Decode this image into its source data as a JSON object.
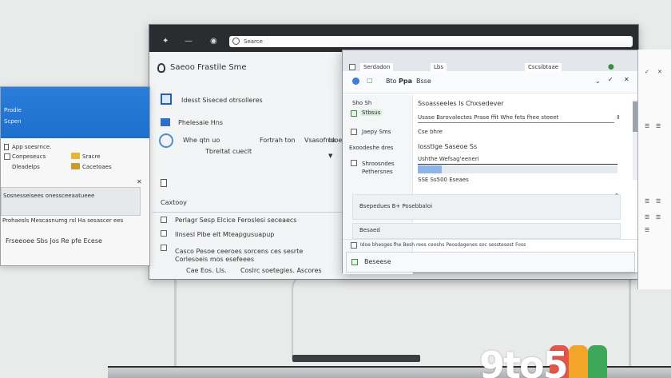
{
  "back_window": {
    "address": "Searce",
    "toolbar_title": "Saeoo Frastile Sme",
    "row1": "Idesst Siseced otrsolleres",
    "row2": "Phelesaie Hns",
    "row3_a": "Whe qtn uo",
    "row3_b": "Fortrah ton",
    "row3_c": "Vsasofroa",
    "row3_d": "Idoe",
    "row4": "Tbreltat cueclt",
    "section_label": "Caxtooy",
    "list1": "Perlagr Sesp Elcice Feroslesi seceaecs",
    "list2": "Ilnsesl Pibe elt Mteapgusuapup",
    "list3": "Casco Pesoe ceeroes sorcens ces sesrte",
    "list4": "Corlesoeis mos esefeees",
    "list5": "Cae Eos. Lls.",
    "list6": "Coslrc soetegies. Ascores"
  },
  "left_window": {
    "header1": "Prodie",
    "header2": "Scpen",
    "row1": "App soesrnce.",
    "row2": "Conpeseucs",
    "row3": "Sracre",
    "row4": "Dleadelps",
    "row5": "Cacetoaes",
    "list1": "Sosnesseisees onessceeaatueee",
    "list2": "Prohaesls Mescasnumg rsl Ha sesascer ees",
    "footer": "Frseeoee Sbs Jos Re pfe Ecese"
  },
  "front_window": {
    "tab1": "Serdadon",
    "tab2": "Lbs",
    "tab3": "Cscsibtaae",
    "title": "Bsse",
    "tb_label1": "Bto",
    "tb_label2": "Ppa",
    "side1": "Sho Sh",
    "side2": "Stbsus",
    "side3": "Jaepy Sms",
    "side4": "Exoodeshe dres",
    "side5": "Shroosndes",
    "side6": "Pethersnes",
    "label1": "Ssoasseeles Is Chxsedever",
    "input1": "Usase Bsrovalectes Prase ffit Whe fets fhee steeet",
    "label2": "Cse bhre",
    "label3": "Iosstlge Saseoe Ss",
    "input2": "Ushthe Wefsag'eeneri",
    "label4": "SSE Ss500 Eseaes",
    "card1": "Bsepedues B+ Posebbaloi",
    "card2": "Besaed",
    "status": "Idoe bhesges fhe Besh rees ceoshs Peosdagenes soc sesstesest Foss",
    "bottom_button": "Beseese",
    "progress_fraction": 0.12
  },
  "watermark": {
    "text": "9to5"
  },
  "colors": {
    "accent_blue": "#2b7dd9",
    "titlebar_dark": "#2a2c30"
  }
}
